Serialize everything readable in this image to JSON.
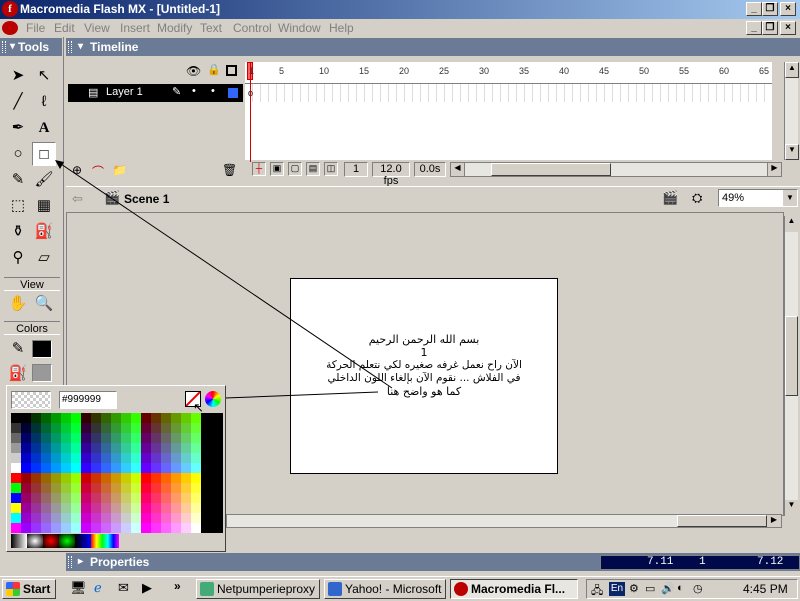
{
  "window": {
    "title": "Macromedia Flash MX - [Untitled-1]",
    "app_icon_glyph": "f"
  },
  "menu": [
    "File",
    "Edit",
    "View",
    "Insert",
    "Modify",
    "Text",
    "Control",
    "Window",
    "Help"
  ],
  "tools_panel": {
    "title": "Tools",
    "view_label": "View",
    "colors_label": "Colors"
  },
  "timeline": {
    "title": "Timeline",
    "layer_name": "Layer 1",
    "frame_numbers": [
      "1",
      "5",
      "10",
      "15",
      "20",
      "25",
      "30",
      "35",
      "40",
      "45",
      "50",
      "55",
      "60",
      "65"
    ],
    "current_frame": "1",
    "fps": "12.0 fps",
    "elapsed": "0.0s"
  },
  "scene": {
    "name": "Scene 1",
    "zoom": "49%"
  },
  "swatches": {
    "hex_value": "#999999"
  },
  "stage_text": {
    "line1": "بسم الله الرحمن الرحيم",
    "line2": "1",
    "line3": "الآن راح نعمل غرفه صغيره لكي نتعلم الحركة",
    "line4": "في الفلاش ... نقوم الآن بإلغاء اللون الداخلي",
    "line5": "كما هو واضح هنا"
  },
  "properties": {
    "title": "Properties"
  },
  "status_readout": {
    "left": "7.11",
    "middle": "1",
    "right": "7.12"
  },
  "taskbar": {
    "start": "Start",
    "buttons": [
      "Netpumperieproxy",
      "Yahoo! - Microsoft ...",
      "Macromedia Fl..."
    ],
    "tray_lang": "En",
    "clock": "4:45 PM"
  },
  "colors": {
    "title_bar": "#0a246a",
    "panel_header": "#6b7b96",
    "stroke_swatch": "#000000",
    "fill_swatch": "#999999"
  }
}
